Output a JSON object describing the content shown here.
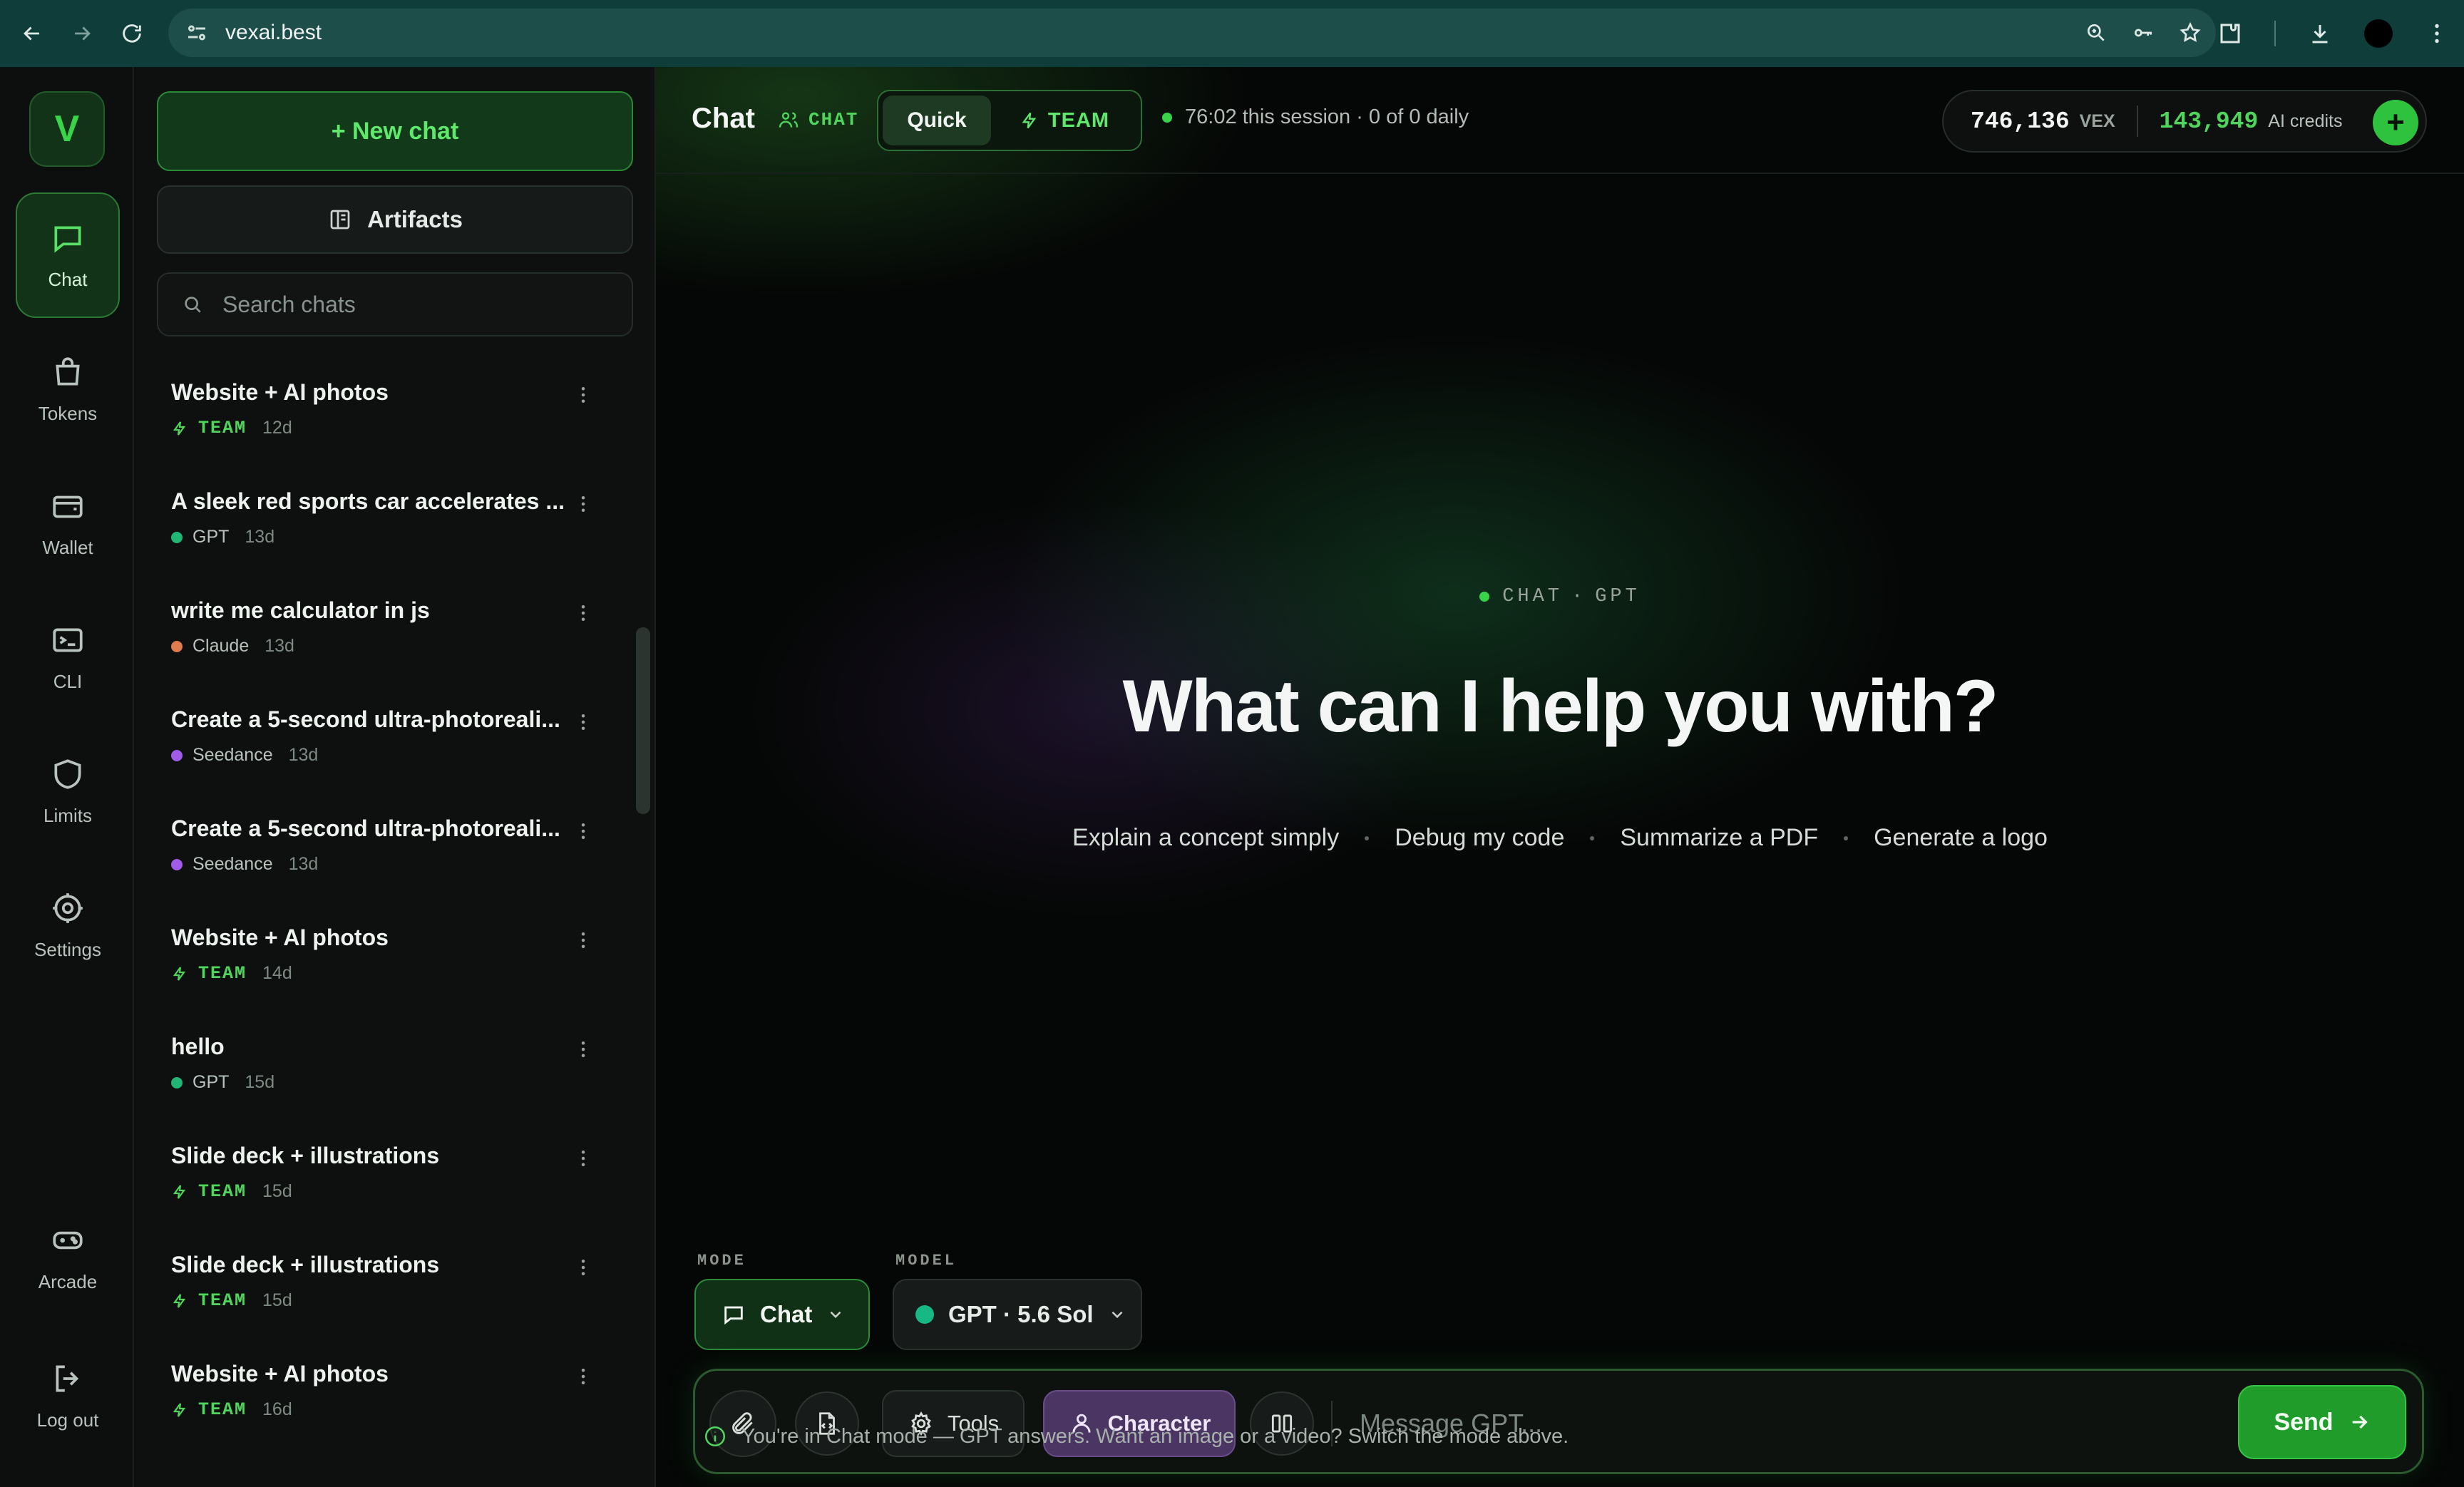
{
  "browser": {
    "url": "vexai.best"
  },
  "rail": {
    "logo": "V",
    "items": [
      {
        "label": "Chat",
        "icon": "message-square-icon",
        "active": true
      },
      {
        "label": "Tokens",
        "icon": "shopping-bag-icon"
      },
      {
        "label": "Wallet",
        "icon": "wallet-icon"
      },
      {
        "label": "CLI",
        "icon": "terminal-icon"
      },
      {
        "label": "Limits",
        "icon": "shield-icon"
      },
      {
        "label": "Settings",
        "icon": "gear-icon"
      }
    ],
    "bottom_items": [
      {
        "label": "Arcade",
        "icon": "gamepad-icon"
      },
      {
        "label": "Log out",
        "icon": "logout-icon"
      }
    ]
  },
  "sidebar": {
    "new_chat_label": "+ New chat",
    "artifacts_label": "Artifacts",
    "search_placeholder": "Search chats",
    "chats": [
      {
        "title": "Website + AI photos",
        "tag": "TEAM",
        "age": "12d"
      },
      {
        "title": "A sleek red sports car accelerates ...",
        "model": "GPT",
        "model_color": "#22b573",
        "age": "13d"
      },
      {
        "title": "write me calculator in js",
        "model": "Claude",
        "model_color": "#e07a4f",
        "age": "13d"
      },
      {
        "title": "Create a 5-second ultra-photoreali...",
        "model": "Seedance",
        "model_color": "#a05ce6",
        "age": "13d"
      },
      {
        "title": "Create a 5-second ultra-photoreali...",
        "model": "Seedance",
        "model_color": "#a05ce6",
        "age": "13d"
      },
      {
        "title": "Website + AI photos",
        "tag": "TEAM",
        "age": "14d"
      },
      {
        "title": "hello",
        "model": "GPT",
        "model_color": "#22b573",
        "age": "15d"
      },
      {
        "title": "Slide deck + illustrations",
        "tag": "TEAM",
        "age": "15d"
      },
      {
        "title": "Slide deck + illustrations",
        "tag": "TEAM",
        "age": "15d"
      },
      {
        "title": "Website + AI photos",
        "tag": "TEAM",
        "age": "16d"
      }
    ]
  },
  "header": {
    "title": "Chat",
    "chat_tag": "CHAT",
    "quick_label": "Quick",
    "team_label": "TEAM",
    "session_text": "76:02 this session · 0 of 0 daily",
    "vex_amount": "746,136",
    "vex_unit": "VEX",
    "ai_amount": "143,949",
    "ai_unit": "AI credits",
    "add_label": "+"
  },
  "hero": {
    "tag_left": "CHAT",
    "tag_sep": "·",
    "tag_right": "GPT",
    "title": "What can I help you with?",
    "suggestions": [
      "Explain a concept simply",
      "Debug my code",
      "Summarize a PDF",
      "Generate a logo"
    ]
  },
  "composer": {
    "mode_label": "MODE",
    "model_label": "MODEL",
    "mode_value": "Chat",
    "model_value": "GPT · 5.6 Sol",
    "tools_label": "Tools",
    "character_label": "Character",
    "placeholder": "Message GPT...",
    "send_label": "Send",
    "hint": "You're in Chat mode — GPT answers. Want an image or a video? Switch the mode above."
  },
  "colors": {
    "accent": "#39d44a",
    "character": "#4a3563"
  }
}
